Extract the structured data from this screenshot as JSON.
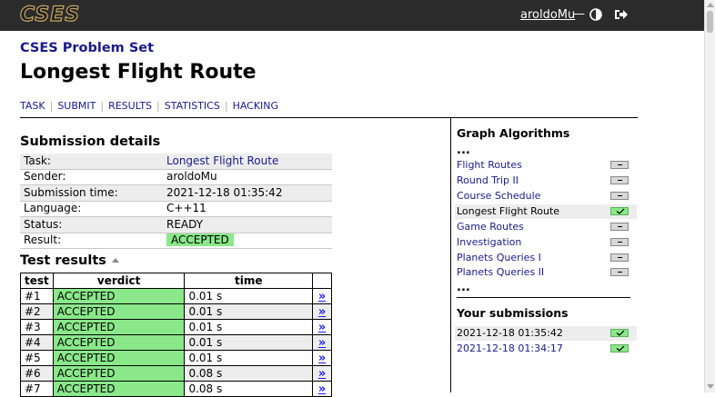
{
  "header": {
    "logo": "CSES",
    "username": "aroldoMu",
    "separator": "—"
  },
  "site_title": "CSES Problem Set",
  "page_title": "Longest Flight Route",
  "nav": [
    "TASK",
    "SUBMIT",
    "RESULTS",
    "STATISTICS",
    "HACKING"
  ],
  "submission": {
    "heading": "Submission details",
    "rows": [
      {
        "label": "Task:",
        "value": "Longest Flight Route"
      },
      {
        "label": "Sender:",
        "value": "aroldoMu"
      },
      {
        "label": "Submission time:",
        "value": "2021-12-18 01:35:42"
      },
      {
        "label": "Language:",
        "value": "C++11"
      },
      {
        "label": "Status:",
        "value": "READY"
      },
      {
        "label": "Result:",
        "value": "ACCEPTED"
      }
    ]
  },
  "tests": {
    "heading": "Test results",
    "columns": [
      "test",
      "verdict",
      "time"
    ],
    "link_symbol": "»",
    "rows": [
      {
        "test": "#1",
        "verdict": "ACCEPTED",
        "time": "0.01 s"
      },
      {
        "test": "#2",
        "verdict": "ACCEPTED",
        "time": "0.01 s"
      },
      {
        "test": "#3",
        "verdict": "ACCEPTED",
        "time": "0.01 s"
      },
      {
        "test": "#4",
        "verdict": "ACCEPTED",
        "time": "0.01 s"
      },
      {
        "test": "#5",
        "verdict": "ACCEPTED",
        "time": "0.01 s"
      },
      {
        "test": "#6",
        "verdict": "ACCEPTED",
        "time": "0.08 s"
      },
      {
        "test": "#7",
        "verdict": "ACCEPTED",
        "time": "0.08 s"
      }
    ]
  },
  "sidebar": {
    "heading": "Graph Algorithms",
    "ellipsis": "...",
    "tasks": [
      {
        "name": "Flight Routes",
        "solved": false
      },
      {
        "name": "Round Trip II",
        "solved": false
      },
      {
        "name": "Course Schedule",
        "solved": false
      },
      {
        "name": "Longest Flight Route",
        "solved": true
      },
      {
        "name": "Game Routes",
        "solved": false
      },
      {
        "name": "Investigation",
        "solved": false
      },
      {
        "name": "Planets Queries I",
        "solved": false
      },
      {
        "name": "Planets Queries II",
        "solved": false
      }
    ],
    "submissions_heading": "Your submissions",
    "submissions": [
      {
        "time": "2021-12-18 01:35:42",
        "accepted": true
      },
      {
        "time": "2021-12-18 01:34:17",
        "accepted": true
      }
    ]
  },
  "colors": {
    "accepted": "#8ae88a",
    "link": "#1a1a8c",
    "topbar": "#2b2b2b"
  }
}
